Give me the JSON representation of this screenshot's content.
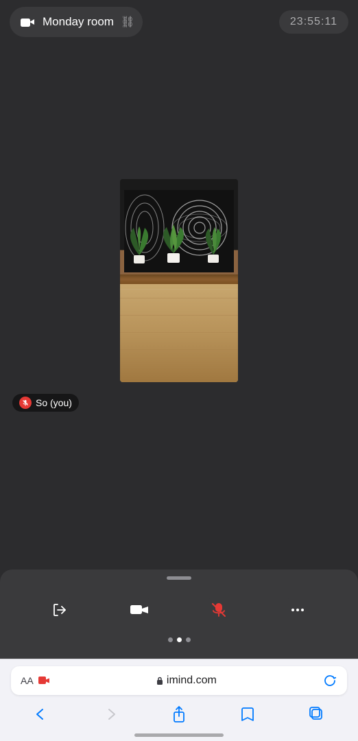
{
  "header": {
    "room_name": "Monday room",
    "timestamp": "23:55:11",
    "link_icon": "🔗"
  },
  "video": {
    "user_label": "So  (you)",
    "muted": true
  },
  "controls": {
    "dots": [
      "inactive",
      "active",
      "inactive"
    ],
    "buttons": [
      {
        "id": "leave",
        "label": "Leave"
      },
      {
        "id": "camera",
        "label": "Camera"
      },
      {
        "id": "mic",
        "label": "Mic"
      },
      {
        "id": "more",
        "label": "More"
      }
    ]
  },
  "safari": {
    "aa_label": "AA",
    "lock_icon": "lock",
    "domain": "imind.com",
    "back_disabled": false,
    "forward_disabled": true
  }
}
